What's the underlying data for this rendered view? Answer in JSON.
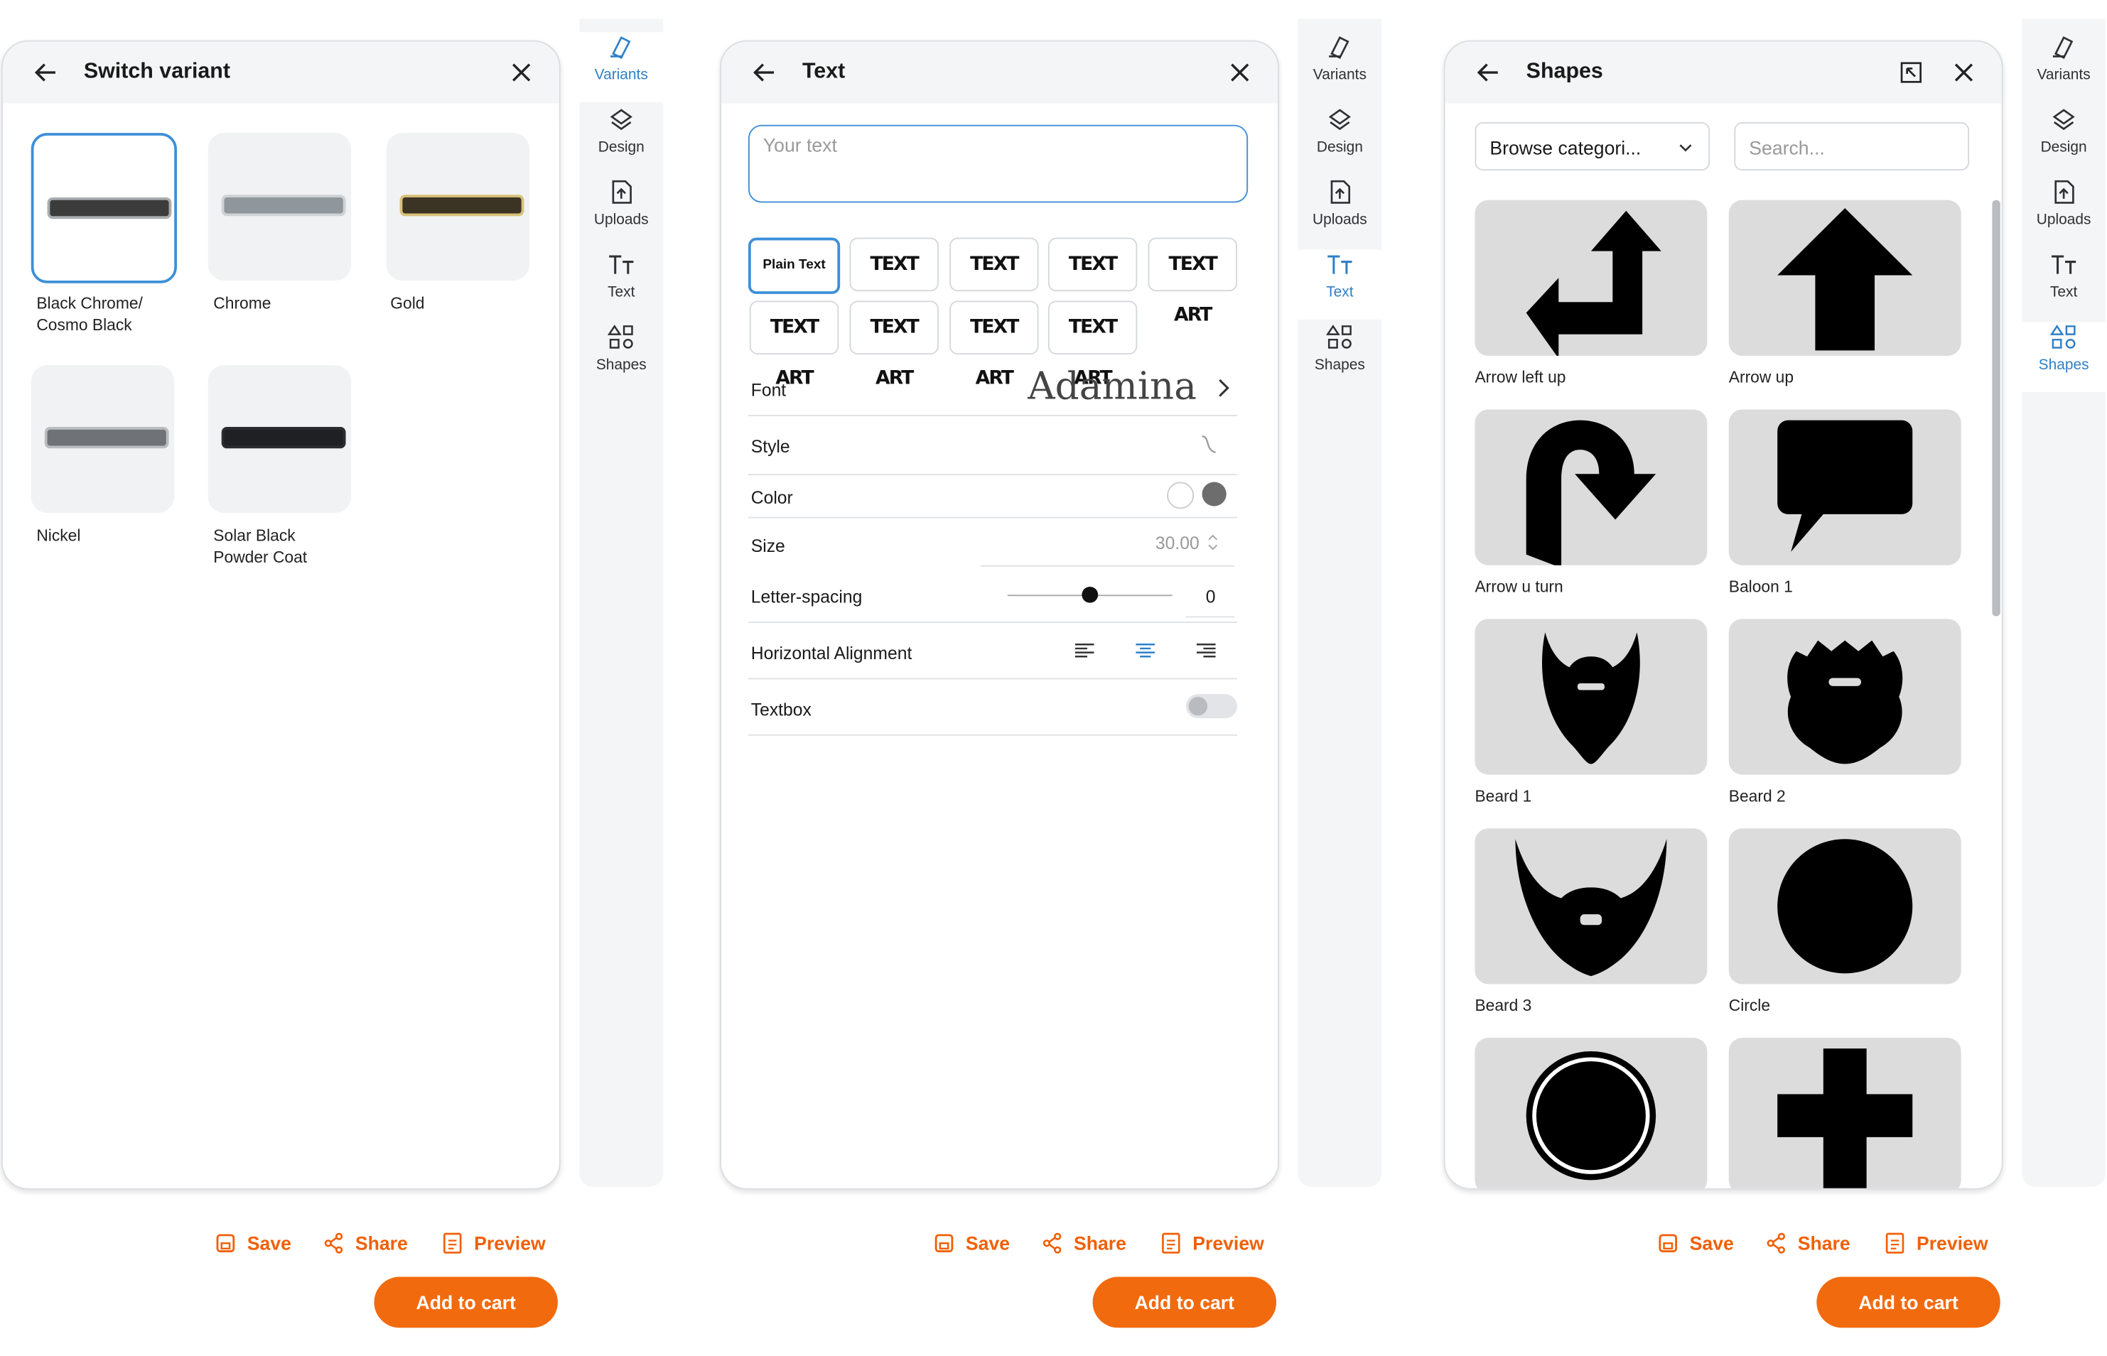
{
  "rail": {
    "items": [
      {
        "label": "Variants",
        "icon": "variants-icon"
      },
      {
        "label": "Design",
        "icon": "layers-icon"
      },
      {
        "label": "Uploads",
        "icon": "upload-icon"
      },
      {
        "label": "Text",
        "icon": "text-icon"
      },
      {
        "label": "Shapes",
        "icon": "shapes-icon"
      }
    ]
  },
  "variants_panel": {
    "title": "Switch variant",
    "items": [
      {
        "label": "Black Chrome/\nCosmo Black",
        "selected": true,
        "color": "#3c3c3c"
      },
      {
        "label": "Chrome",
        "color": "#8f969c"
      },
      {
        "label": "Gold",
        "color": "#d8c27a"
      },
      {
        "label": "Nickel",
        "color": "#6f7377"
      },
      {
        "label": "Solar Black\nPowder Coat",
        "color": "#1e2023"
      }
    ]
  },
  "text_panel": {
    "title": "Text",
    "placeholder": "Your text",
    "styles": [
      "Plain Text",
      "TEXT ART",
      "TEXT ART",
      "TEXT ART",
      "TEXT ART",
      "TEXT ART",
      "TEXT ART",
      "TEXT ART",
      "TEXT ART"
    ],
    "font_label": "Font",
    "font_value": "Adamina",
    "style_label": "Style",
    "color_label": "Color",
    "size_label": "Size",
    "size_value": "30.00",
    "letter_spacing_label": "Letter-spacing",
    "letter_spacing_value": "0",
    "alignment_label": "Horizontal Alignment",
    "textbox_label": "Textbox"
  },
  "shapes_panel": {
    "title": "Shapes",
    "category_placeholder": "Browse categori...",
    "search_placeholder": "Search...",
    "items": [
      {
        "label": "Arrow left up"
      },
      {
        "label": "Arrow up"
      },
      {
        "label": "Arrow u turn"
      },
      {
        "label": "Baloon 1"
      },
      {
        "label": "Beard 1"
      },
      {
        "label": "Beard 2"
      },
      {
        "label": "Beard 3"
      },
      {
        "label": "Circle"
      },
      {
        "label": ""
      },
      {
        "label": ""
      }
    ]
  },
  "footer": {
    "save": "Save",
    "share": "Share",
    "preview": "Preview",
    "add_to_cart": "Add to cart"
  },
  "colors": {
    "accent": "#f26a0e",
    "selected": "#3f8fd8"
  }
}
